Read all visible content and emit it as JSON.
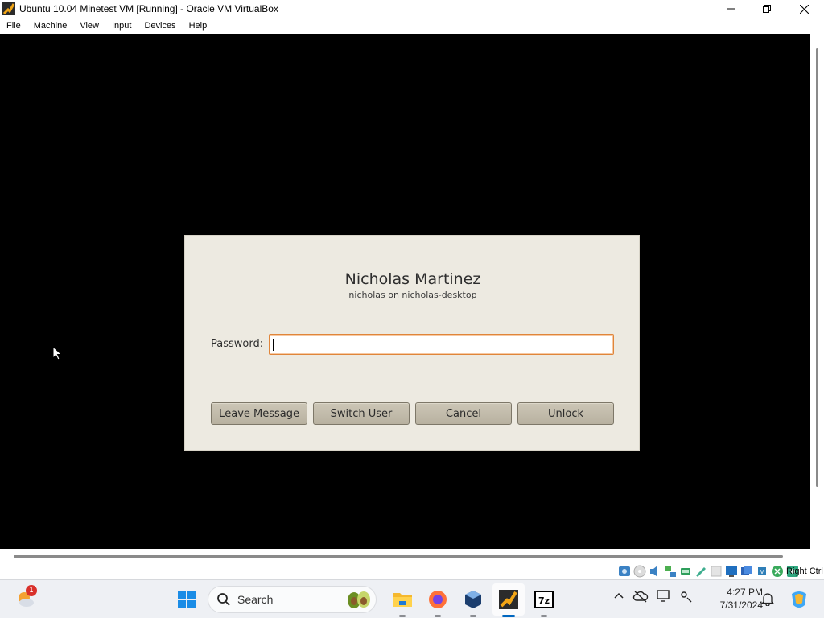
{
  "window": {
    "title": "Ubuntu 10.04 Minetest VM [Running] - Oracle VM VirtualBox",
    "controls": [
      "minimize",
      "maximize",
      "close"
    ]
  },
  "menubar": {
    "items": [
      {
        "label": "File"
      },
      {
        "label": "Machine"
      },
      {
        "label": "View"
      },
      {
        "label": "Input"
      },
      {
        "label": "Devices"
      },
      {
        "label": "Help"
      }
    ]
  },
  "lock_dialog": {
    "user_name": "Nicholas Martinez",
    "user_host": "nicholas on nicholas-desktop",
    "password_label": "Password:",
    "password_value": "",
    "buttons": {
      "leave_message": {
        "mnemonic": "L",
        "rest": "eave Message"
      },
      "switch_user": {
        "mnemonic": "S",
        "rest": "witch User"
      },
      "cancel": {
        "mnemonic": "C",
        "rest": "ancel"
      },
      "unlock": {
        "mnemonic": "U",
        "rest": "nlock"
      }
    }
  },
  "vm_status": {
    "icons": [
      "hard-disk-icon",
      "optical-drive-icon",
      "audio-icon",
      "network-icon",
      "usb-icon",
      "shared-folders-icon",
      "display-icon",
      "recording-icon",
      "cpu-icon",
      "mouse-integration-icon",
      "keyboard-icon"
    ],
    "host_key": "Right Ctrl"
  },
  "taskbar": {
    "weather_badge": "1",
    "search_label": "Search",
    "apps": [
      "file-explorer-icon",
      "firefox-icon",
      "virtualbox-icon",
      "virtualbox-vm-icon",
      "7zip-icon"
    ],
    "tray": [
      "chevron-up-icon",
      "cloud-icon",
      "display-icon",
      "location-icon"
    ],
    "time": "4:27 PM",
    "date": "7/31/2024"
  },
  "colors": {
    "dialog_bg": "#edeae1",
    "focus_border": "#e0853a",
    "taskbar_active": "#0067c0"
  }
}
